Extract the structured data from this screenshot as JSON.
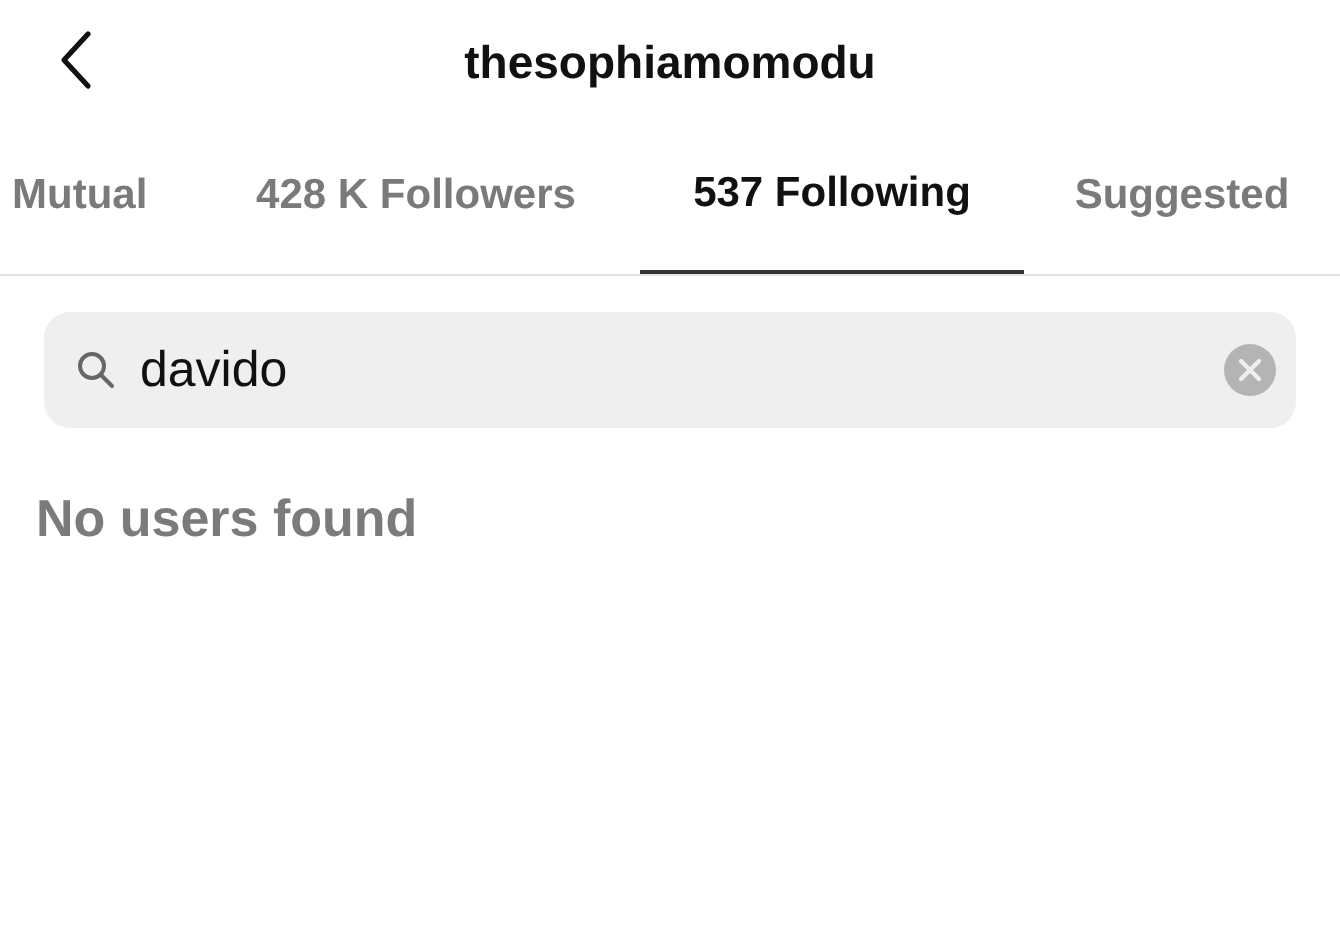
{
  "header": {
    "title": "thesophiamomodu"
  },
  "tabs": [
    {
      "label": "Mutual",
      "selected": false
    },
    {
      "label": "428 K Followers",
      "selected": false
    },
    {
      "label": "537 Following",
      "selected": true
    },
    {
      "label": "Suggested",
      "selected": false
    }
  ],
  "search": {
    "value": "davido"
  },
  "empty_message": "No users found"
}
